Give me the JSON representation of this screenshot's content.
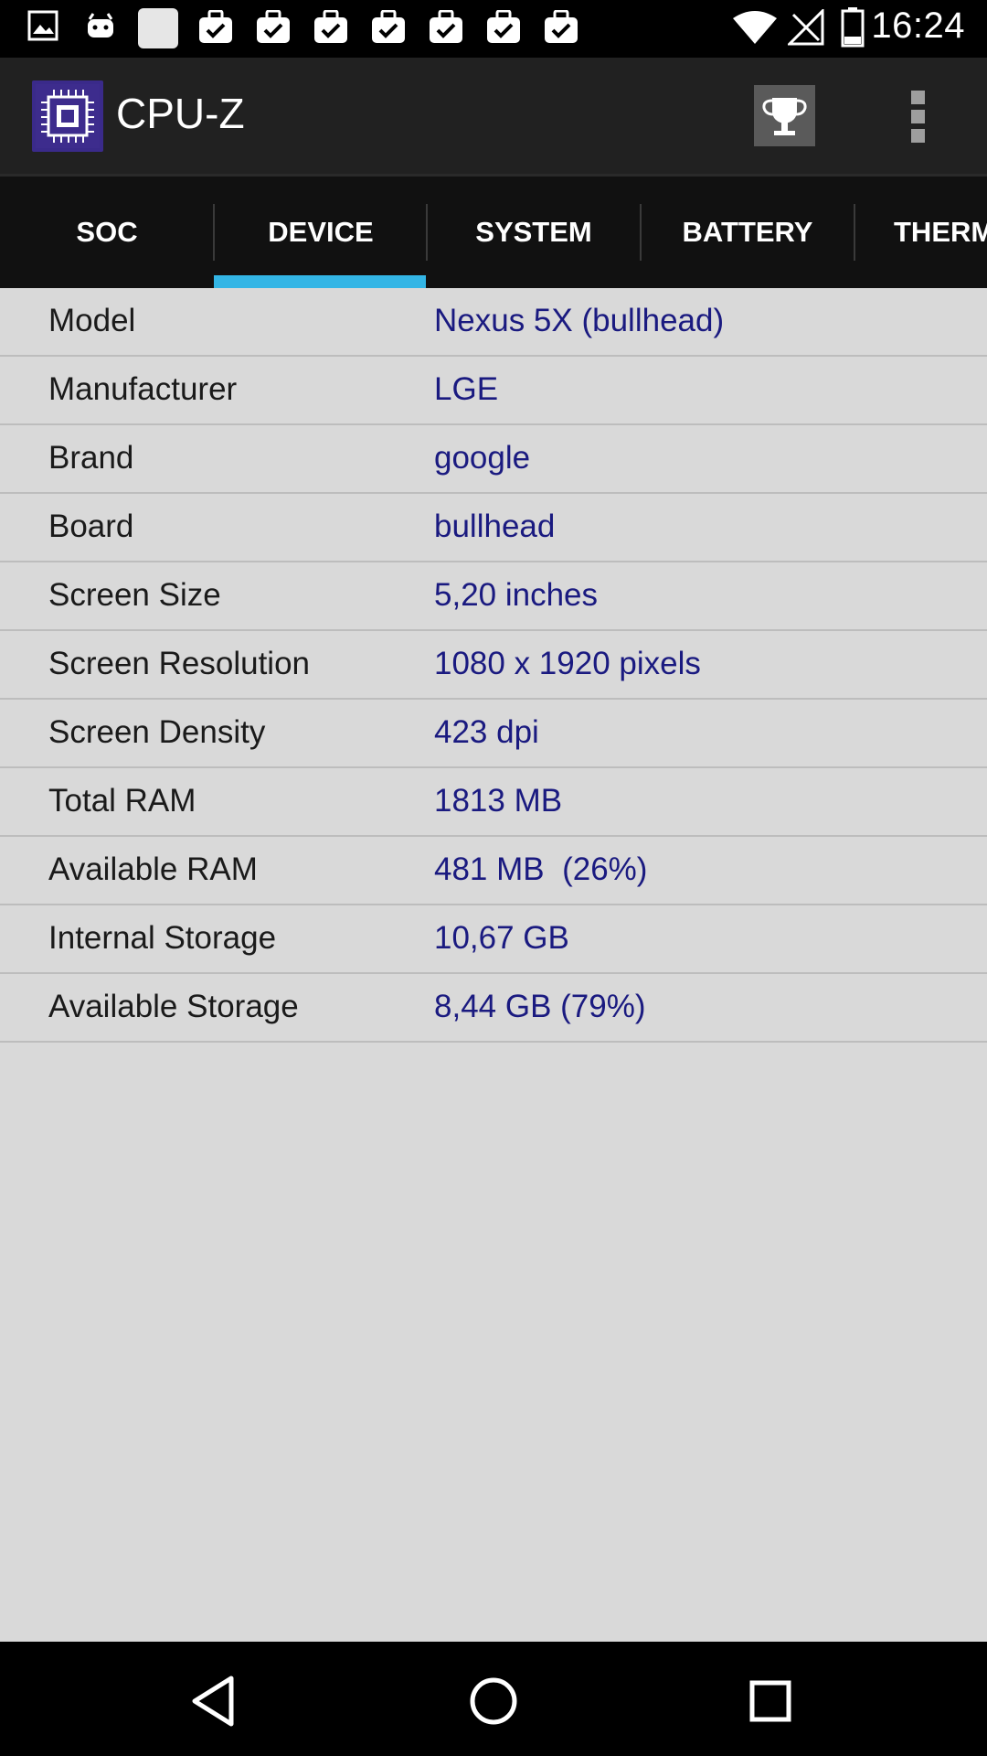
{
  "status_bar": {
    "time": "16:24",
    "icons": [
      "image-icon",
      "android-icon",
      "blank-notification-icon",
      "check-bag-icon",
      "check-bag-icon",
      "check-bag-icon",
      "check-bag-icon",
      "check-bag-icon",
      "check-bag-icon",
      "check-bag-icon",
      "wifi-icon",
      "no-signal-icon",
      "battery-icon"
    ]
  },
  "app_bar": {
    "title": "CPU-Z",
    "actions": [
      "trophy-icon",
      "overflow-menu-icon"
    ]
  },
  "tabs": [
    {
      "label": "SOC",
      "selected": false
    },
    {
      "label": "DEVICE",
      "selected": true
    },
    {
      "label": "SYSTEM",
      "selected": false
    },
    {
      "label": "BATTERY",
      "selected": false
    },
    {
      "label": "THERM",
      "selected": false
    }
  ],
  "rows": [
    {
      "label": "Model",
      "value": "Nexus 5X (bullhead)"
    },
    {
      "label": "Manufacturer",
      "value": "LGE"
    },
    {
      "label": "Brand",
      "value": "google"
    },
    {
      "label": "Board",
      "value": "bullhead"
    },
    {
      "label": "Screen Size",
      "value": "5,20 inches"
    },
    {
      "label": "Screen Resolution",
      "value": "1080 x 1920 pixels"
    },
    {
      "label": "Screen Density",
      "value": "423 dpi"
    },
    {
      "label": "Total RAM",
      "value": "1813 MB"
    },
    {
      "label": "Available RAM",
      "value": "481 MB  (26%)"
    },
    {
      "label": "Internal Storage",
      "value": "10,67 GB"
    },
    {
      "label": "Available Storage",
      "value": "8,44 GB (79%)"
    }
  ],
  "nav_bar": {
    "buttons": [
      "back-icon",
      "home-icon",
      "recents-icon"
    ]
  },
  "colors": {
    "accent": "#33b5e5",
    "value_text": "#1a1a80",
    "content_bg": "#d9d9d9",
    "app_bar_bg": "#212121",
    "tab_bar_bg": "#111111"
  }
}
